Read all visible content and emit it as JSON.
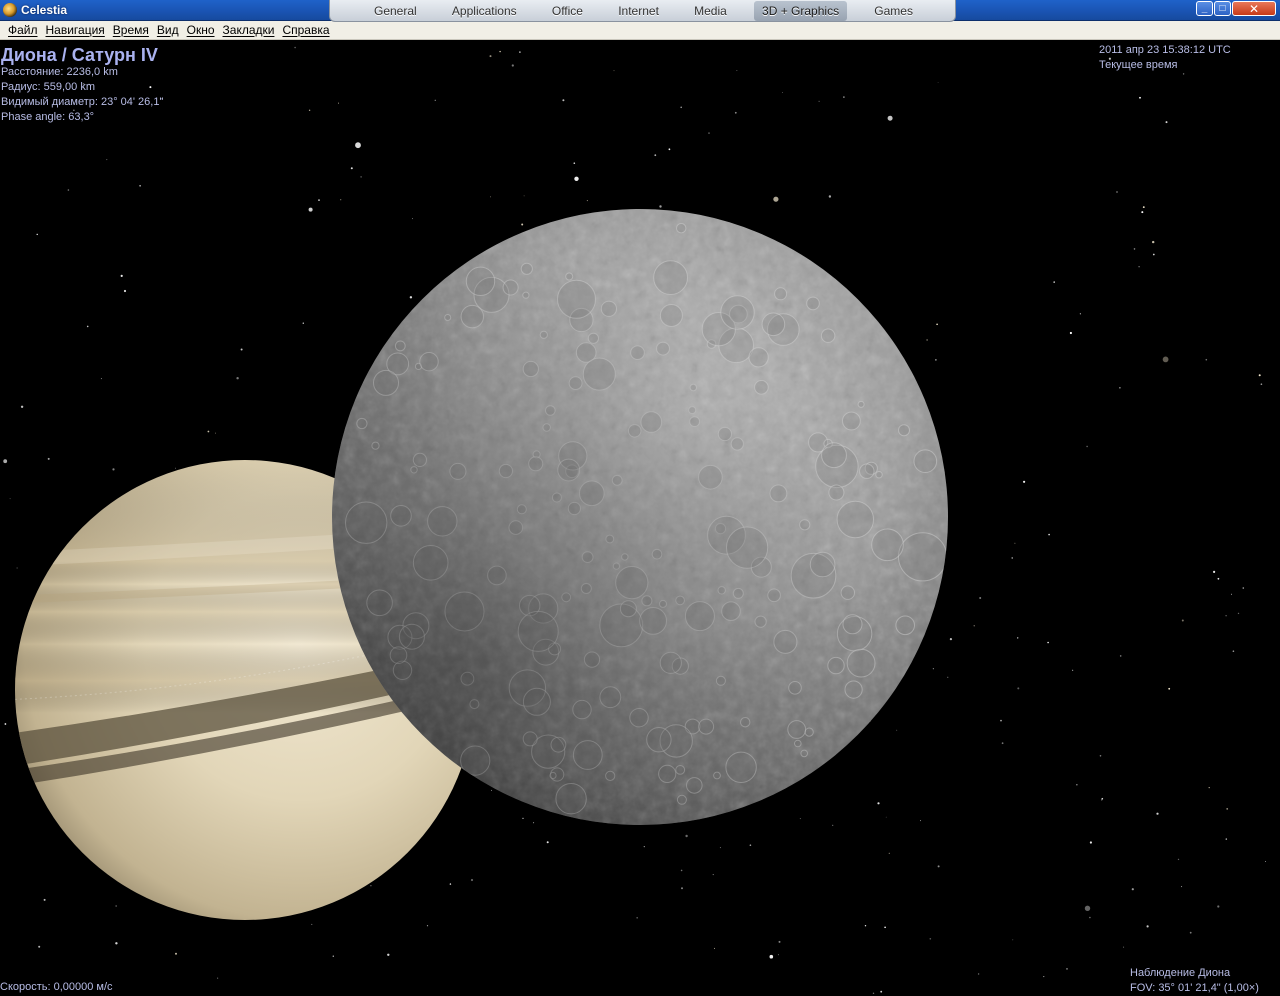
{
  "window": {
    "title": "Celestia",
    "buttons": {
      "minimize": "_",
      "maximize": "□",
      "close": "✕"
    }
  },
  "dock": {
    "items": [
      "General",
      "Applications",
      "Office",
      "Internet",
      "Media",
      "3D + Graphics",
      "Games"
    ],
    "active": "3D + Graphics"
  },
  "menu": {
    "items": [
      "Файл",
      "Навигация",
      "Время",
      "Вид",
      "Окно",
      "Закладки",
      "Справка"
    ]
  },
  "hud": {
    "object_name": "Диона / Сатурн IV",
    "distance": "Расстояние: 2236,0 km",
    "radius": "Радиус: 559,00 km",
    "apparent_diameter": "Видимый диаметр: 23° 04' 26,1\"",
    "phase_angle": "Phase angle: 63,3°",
    "datetime": "2011 апр 23 15:38:12 UTC",
    "time_mode": "Текущее время",
    "speed": "Скорость: 0,00000 м/с",
    "tracking": "Наблюдение Диона",
    "fov": "FOV: 35° 01' 21,4\" (1,00×)"
  },
  "colors": {
    "hud_text": "#b8bde6",
    "titlebar": "#1f62c9",
    "menubar": "#f1efe6",
    "space": "#000000"
  }
}
